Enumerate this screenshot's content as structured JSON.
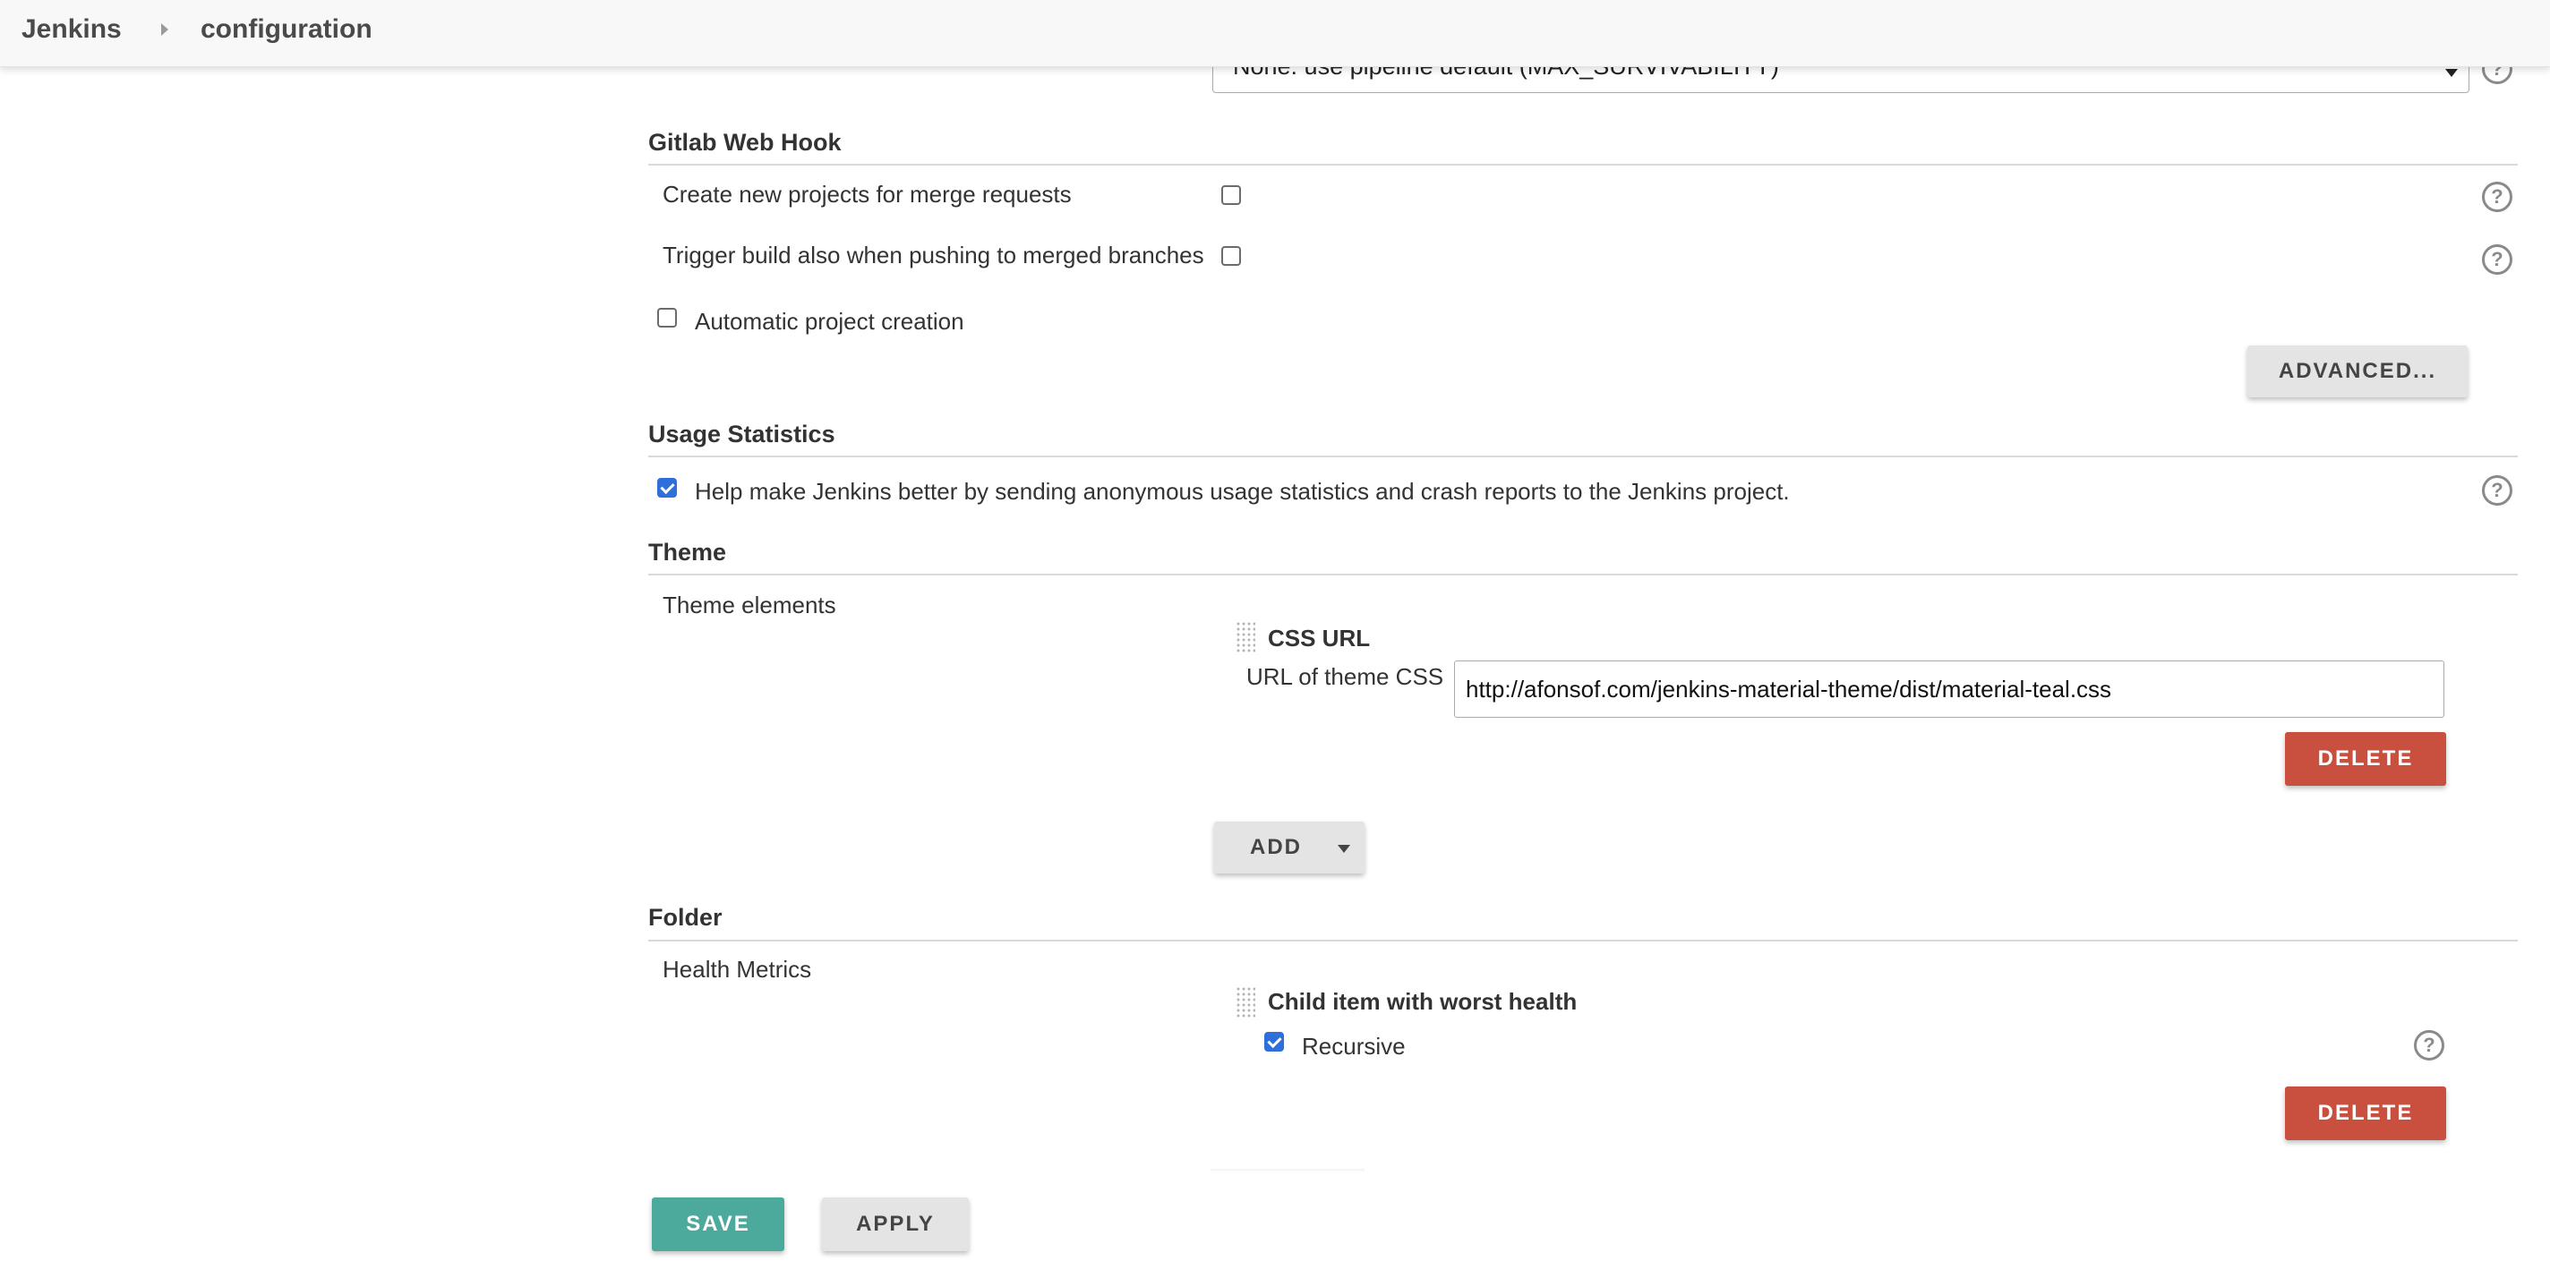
{
  "breadcrumb": {
    "root": "Jenkins",
    "current": "configuration"
  },
  "durability": {
    "selected": "None: use pipeline default (MAX_SURVIVABILITY)"
  },
  "gitlab": {
    "title": "Gitlab Web Hook",
    "merge_requests_label": "Create new projects for merge requests",
    "merge_requests_checked": false,
    "merged_branches_label": "Trigger build also when pushing to merged branches",
    "merged_branches_checked": false,
    "auto_create_label": "Automatic project creation",
    "auto_create_checked": false,
    "advanced_label": "ADVANCED..."
  },
  "usage": {
    "title": "Usage Statistics",
    "help_label": "Help make Jenkins better by sending anonymous usage statistics and crash reports to the Jenkins project.",
    "checked": true
  },
  "theme": {
    "title": "Theme",
    "elements_label": "Theme elements",
    "item_title": "CSS URL",
    "url_label": "URL of theme CSS",
    "url_value": "http://afonsof.com/jenkins-material-theme/dist/material-teal.css",
    "delete_label": "DELETE",
    "add_label": "ADD"
  },
  "folder": {
    "title": "Folder",
    "metrics_label": "Health Metrics",
    "item_title": "Child item with worst health",
    "recursive_label": "Recursive",
    "recursive_checked": true,
    "delete_label": "DELETE"
  },
  "footer": {
    "save_label": "SAVE",
    "apply_label": "APPLY"
  },
  "icons": {
    "help": "question-circle-icon",
    "handle": "drag-handle-icon",
    "caret": "caret-down-icon",
    "separator": "breadcrumb-chevron-icon"
  },
  "colors": {
    "delete": "#c9503e",
    "save": "#4caa9c",
    "checkbox": "#2e6fd9"
  }
}
